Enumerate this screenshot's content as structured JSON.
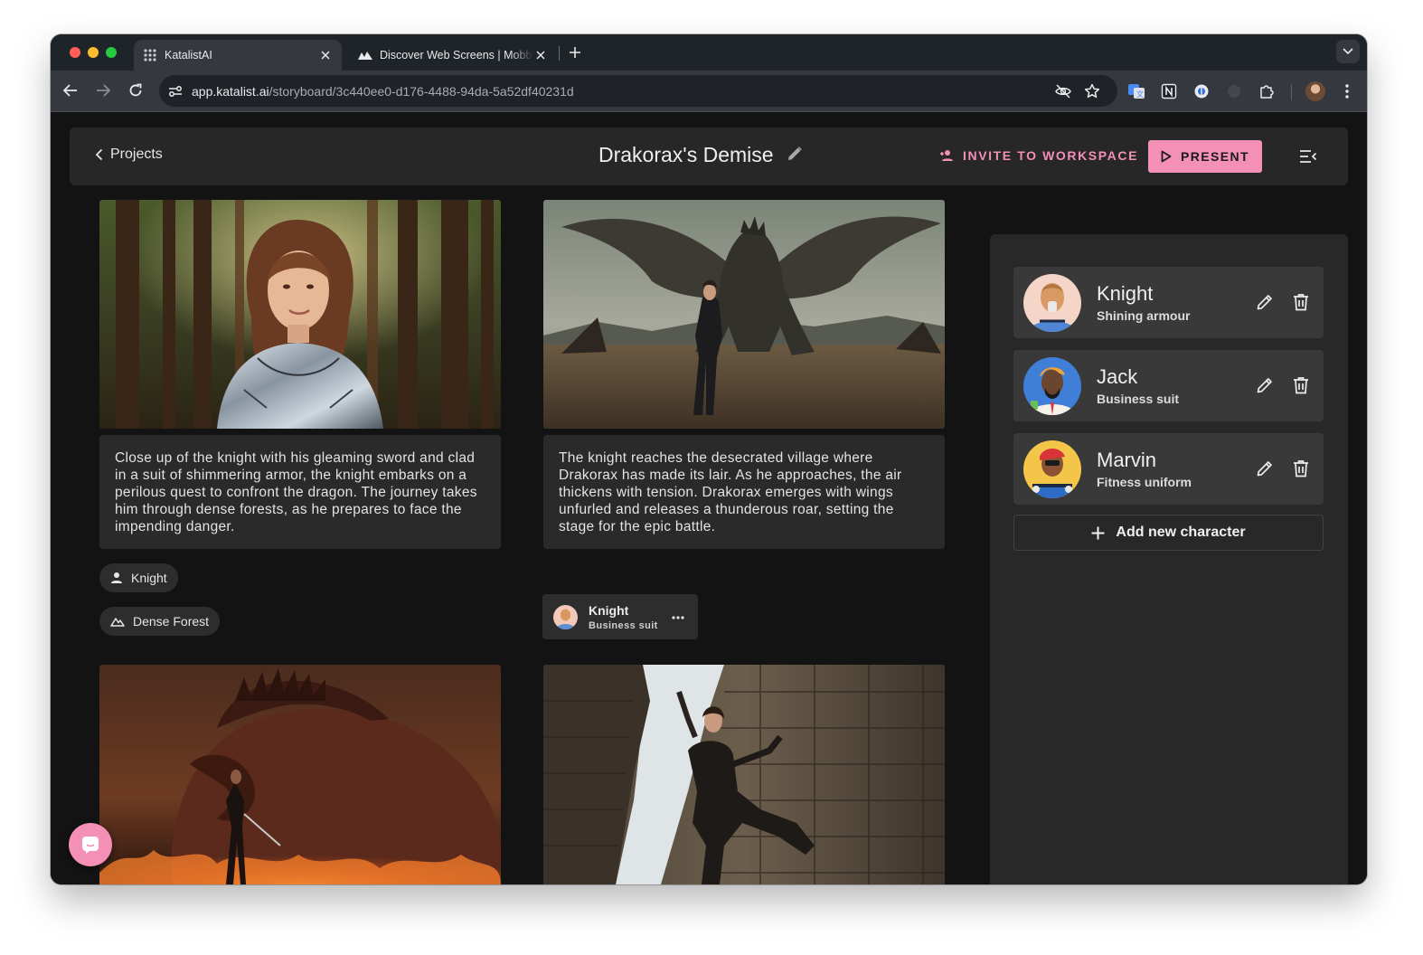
{
  "browser": {
    "tabs": [
      {
        "title": "KatalistAI",
        "active": true
      },
      {
        "title": "Discover Web Screens | Mobbin",
        "active": false
      }
    ],
    "url_domain": "app.katalist.ai",
    "url_path": "/storyboard/3c440ee0-d176-4488-94da-5a52df40231d"
  },
  "header": {
    "back_label": "Projects",
    "title": "Drakorax's Demise",
    "invite_label": "INVITE TO WORKSPACE",
    "present_label": "PRESENT"
  },
  "scenes": [
    {
      "description": "Close up of the knight with his gleaming sword and clad in a suit of shimmering armor, the knight embarks on a perilous quest to confront the dragon. The journey takes him through dense forests, as he prepares to face the impending danger.",
      "character_tag": "Knight",
      "location_tag": "Dense Forest"
    },
    {
      "description": "The knight reaches the desecrated village where Drakorax has made its lair. As he approaches, the air thickens with tension. Drakorax emerges with wings unfurled and releases a thunderous roar, setting the stage for the epic battle.",
      "character": {
        "name": "Knight",
        "outfit": "Business suit"
      }
    }
  ],
  "characters_panel": {
    "characters": [
      {
        "name": "Knight",
        "outfit": "Shining armour"
      },
      {
        "name": "Jack",
        "outfit": "Business suit"
      },
      {
        "name": "Marvin",
        "outfit": "Fitness uniform"
      }
    ],
    "add_label": "Add new character"
  },
  "colors": {
    "accent": "#f48fb6",
    "app_bg": "#131313",
    "panel_bg": "#282828",
    "card_bg": "#393939"
  }
}
